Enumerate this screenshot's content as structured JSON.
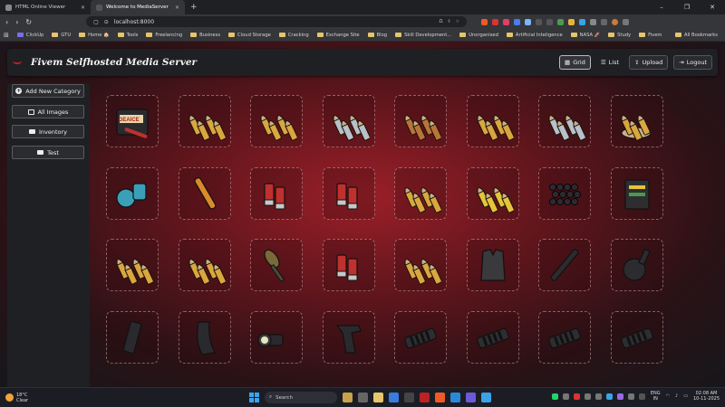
{
  "browser": {
    "tabs": [
      {
        "title": "HTML Online Viewer"
      },
      {
        "title": "Welcome to MediaServer"
      }
    ],
    "new_tab": "+",
    "window_controls": [
      "–",
      "❐",
      "✕"
    ],
    "address": "localhost:8000",
    "zoom_indicator": "Ω",
    "bookmarks": [
      "ClickUp",
      "GTU",
      "Home 🏠",
      "Tools",
      "Freelancing",
      "Business",
      "Cloud Storage",
      "Cracking",
      "Exchange Site",
      "Blog",
      "Skill Development...",
      "Unorganised",
      "Artificial Inteligence",
      "NASA 🚀",
      "Study",
      "Fivem"
    ],
    "all_bookmarks": "All Bookmarks"
  },
  "app": {
    "title": "Fivem Selfhosted Media Server",
    "nav": {
      "grid": "Grid",
      "list": "List",
      "upload": "Upload",
      "logout": "Logout"
    },
    "sidebar": {
      "add_category": "Add New Category",
      "categories": [
        "All Images",
        "Inventory",
        "Test"
      ]
    },
    "colors": {
      "accent": "#b9202a",
      "background_center": "#9b1f28",
      "panel": "#1f2024"
    },
    "items": [
      {
        "icon": "toolbox-icon",
        "label": "DEAICE"
      },
      {
        "icon": "ammo-pistol-icon"
      },
      {
        "icon": "ammo-rifle-icon"
      },
      {
        "icon": "ammo-silver-icon"
      },
      {
        "icon": "ammo-copper-icon"
      },
      {
        "icon": "ammo-brass-icon"
      },
      {
        "icon": "ammo-steel-icon"
      },
      {
        "icon": "ammo-pouch-icon"
      },
      {
        "icon": "grenade-icon"
      },
      {
        "icon": "rocket-icon"
      },
      {
        "icon": "shotgun-shell-icon"
      },
      {
        "icon": "slug-round-icon"
      },
      {
        "icon": "ammo-black-tip-icon"
      },
      {
        "icon": "ammo-yellow-casing-icon"
      },
      {
        "icon": "pellets-icon"
      },
      {
        "icon": "ammo-box-icon"
      },
      {
        "icon": "ammo-long-rifle-icon"
      },
      {
        "icon": "ammo-green-tip-icon"
      },
      {
        "icon": "rpg-rocket-icon"
      },
      {
        "icon": "shotgun-red-shell-icon"
      },
      {
        "icon": "ammo-rifle-2-icon"
      },
      {
        "icon": "body-armor-icon"
      },
      {
        "icon": "barrel-icon"
      },
      {
        "icon": "drum-magazine-icon"
      },
      {
        "icon": "magazine-icon"
      },
      {
        "icon": "curved-magazine-icon"
      },
      {
        "icon": "flashlight-icon"
      },
      {
        "icon": "grip-icon"
      },
      {
        "icon": "suppressor-icon"
      },
      {
        "icon": "muzzle-brake-icon"
      },
      {
        "icon": "compensator-icon"
      },
      {
        "icon": "silencer-icon"
      }
    ]
  },
  "taskbar": {
    "weather_temp": "18°C",
    "weather_desc": "Clear",
    "search": "Search",
    "lang_1": "ENG",
    "lang_2": "IN",
    "time": "02:08 AM",
    "date": "10-11-2025"
  }
}
